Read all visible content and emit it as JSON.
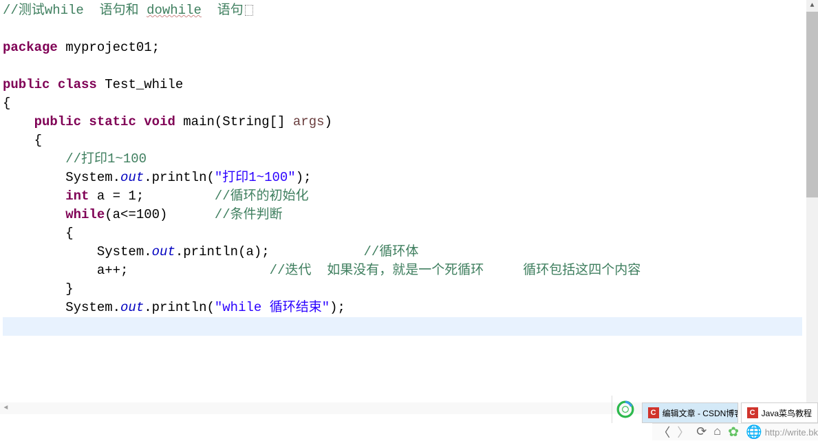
{
  "code": {
    "line1_comment_1": "//",
    "line1_comment_2": "测试",
    "line1_comment_3": "while  ",
    "line1_comment_4": "语句和 ",
    "line1_comment_5": "dowhile",
    "line1_comment_6": "  语句",
    "line2": "",
    "line3_package": "package",
    "line3_name": " myproject01;",
    "line4": "",
    "line5_public": "public",
    "line5_class": " class",
    "line5_name": " Test_while",
    "line6_brace": "{",
    "line7_public": "    public",
    "line7_static": " static",
    "line7_void": " void",
    "line7_main": " main(String[] ",
    "line7_args": "args",
    "line7_close": ")",
    "line8_brace": "    {",
    "line9_comment": "        //打印1~100",
    "line10_sys": "        System.",
    "line10_out": "out",
    "line10_println": ".println(",
    "line10_str": "\"打印1~100\"",
    "line10_end": ");",
    "line11_int": "        int",
    "line11_a": " a = 1;         ",
    "line11_comment": "//循环的初始化",
    "line12_while": "        while",
    "line12_cond": "(a<=100)      ",
    "line12_comment": "//条件判断",
    "line13_brace": "        {",
    "line14_sys": "            System.",
    "line14_out": "out",
    "line14_println": ".println(a);            ",
    "line14_comment": "//循环体",
    "line15_app": "            a++;                  ",
    "line15_comment": "//迭代  如果没有，就是一个死循环     循环包括这四个内容",
    "line16_brace": "        }",
    "line17_sys": "        System.",
    "line17_out": "out",
    "line17_println": ".println(",
    "line17_str": "\"while 循环结束\"",
    "line17_end": ");"
  },
  "taskbar": {
    "tab1_label": "编辑文章 - CSDN博客",
    "tab2_label": "Java菜鸟教程",
    "url": "http://write.bk"
  }
}
